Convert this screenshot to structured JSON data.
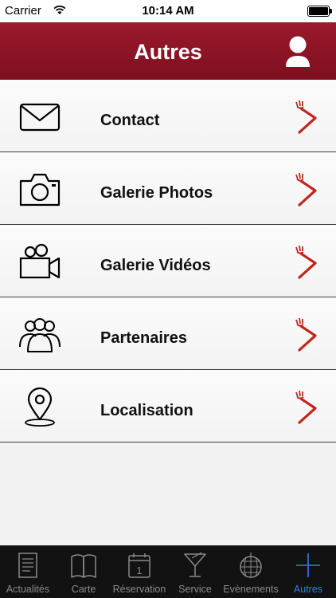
{
  "status": {
    "carrier": "Carrier",
    "time": "10:14 AM"
  },
  "header": {
    "title": "Autres",
    "profile_icon": "user-icon"
  },
  "colors": {
    "accent": "#8a1323",
    "chevron": "#c0261d",
    "tab_active": "#2f7df6"
  },
  "menu": [
    {
      "label": "Contact",
      "icon": "envelope-icon"
    },
    {
      "label": "Galerie Photos",
      "icon": "camera-icon"
    },
    {
      "label": "Galerie Vidéos",
      "icon": "video-camera-icon"
    },
    {
      "label": "Partenaires",
      "icon": "people-icon"
    },
    {
      "label": "Localisation",
      "icon": "location-pin-icon"
    }
  ],
  "tabs": [
    {
      "label": "Actualités",
      "icon": "newspaper-icon"
    },
    {
      "label": "Carte",
      "icon": "book-icon"
    },
    {
      "label": "Réservation",
      "icon": "calendar-icon",
      "calendar_day": "1"
    },
    {
      "label": "Service",
      "icon": "cocktail-icon"
    },
    {
      "label": "Evènements",
      "icon": "disco-ball-icon"
    },
    {
      "label": "Autres",
      "icon": "plus-icon",
      "active": true
    }
  ]
}
